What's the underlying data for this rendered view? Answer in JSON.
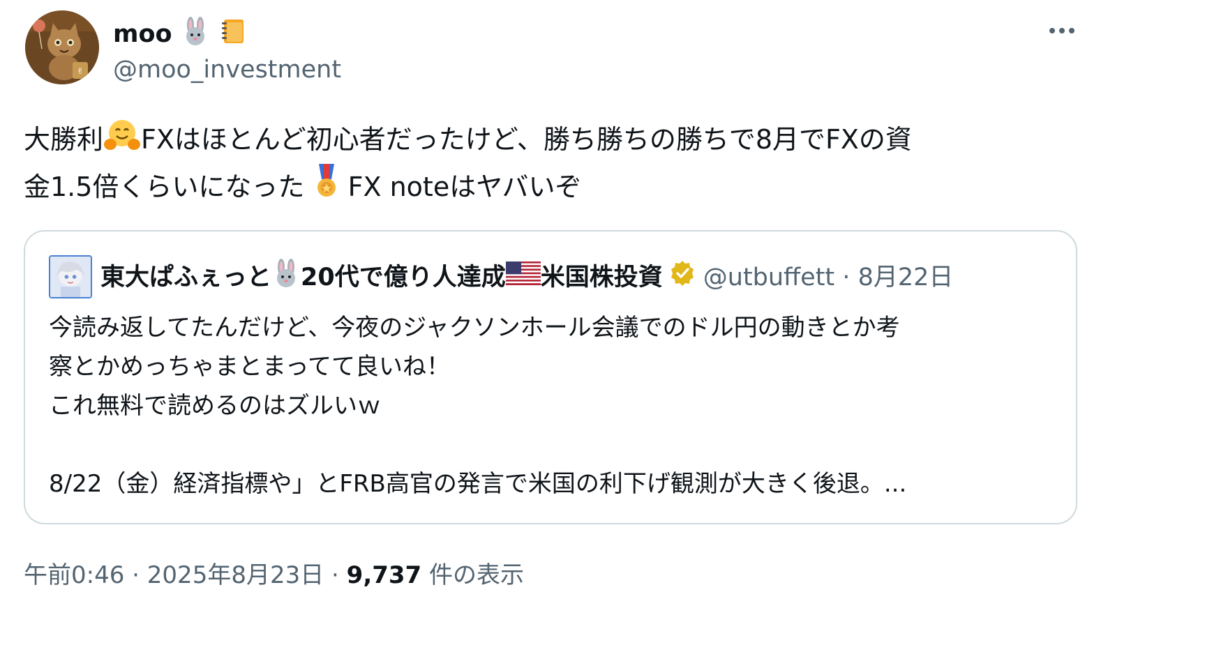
{
  "author": {
    "display_name": "moo",
    "name_emojis": [
      "rabbit-face-emoji",
      "notebook-emoji"
    ],
    "handle": "@moo_investment"
  },
  "tweet": {
    "line1_a": "大勝利",
    "line1_emoji": "hugging-face-emoji",
    "line1_b": "FXはほとんど初心者だったけど、勝ち勝ちの勝ちで8月でFXの資",
    "line2_a": "金1.5倍くらいになった",
    "line2_emoji": "military-medal-emoji",
    "line2_b": "FX noteはヤバいぞ"
  },
  "quote": {
    "name_a": "東大ぱふぇっと",
    "name_emoji_1": "rabbit-face-emoji",
    "name_b": "20代で億り人達成",
    "name_emoji_2": "us-flag-emoji",
    "name_c": "米国株投資",
    "verified": "verified-badge",
    "handle": "@utbuffett",
    "separator": "·",
    "date": "8月22日",
    "lines": [
      "今読み返してたんだけど、今夜のジャクソンホール会議でのドル円の動きとか考",
      "察とかめっちゃまとまってて良いね！",
      "これ無料で読めるのはズルいｗ",
      "",
      "8/22（金）経済指標や」とFRB高官の発言で米国の利下げ観測が大きく後退。..."
    ]
  },
  "footer": {
    "time": "午前0:46",
    "sep1": "·",
    "date": "2025年8月23日",
    "sep2": "·",
    "views_count": "9,737",
    "views_label": "件の表示"
  },
  "colors": {
    "text_primary": "#0f1419",
    "text_secondary": "#536471",
    "border": "#cfd9de",
    "verified_gold": "#e2b719"
  }
}
